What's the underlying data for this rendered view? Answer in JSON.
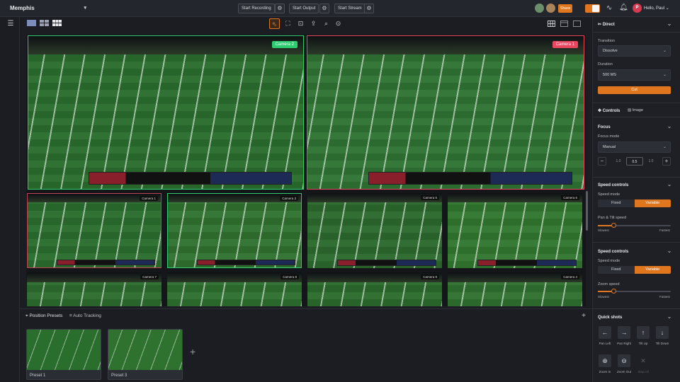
{
  "topbar": {
    "project": "Memphis",
    "start_recording": "Start Recording",
    "start_output": "Start Output",
    "start_stream": "Start Stream",
    "share": "Share",
    "greeting": "Hello, Paul",
    "user_initial": "P"
  },
  "cameras": {
    "main": [
      {
        "label": "Camera 2",
        "color": "#2ecc71"
      },
      {
        "label": "Camera 1",
        "color": "#e8475f"
      }
    ],
    "small": [
      "Camera 1",
      "Camera 3",
      "Camera 5",
      "Camera 6",
      "Camera 7",
      "Camera 8",
      "Camera 9",
      "Camera 4"
    ]
  },
  "bottom": {
    "tab_presets": "Position Presets",
    "tab_tracking": "Auto Tracking",
    "presets": [
      "Preset 1",
      "Preset 3"
    ]
  },
  "right": {
    "section_title": "Direct",
    "transition_label": "Transition",
    "transition_value": "Dissolve",
    "duration_label": "Duration",
    "duration_value": "500 MS",
    "cut_label": "Cut",
    "tab_controls": "Controls",
    "tab_image": "Image",
    "focus": {
      "title": "Focus",
      "mode_label": "Focus mode",
      "mode_value": "Manual",
      "steps": [
        "1.0",
        "0.5",
        "1.0"
      ]
    },
    "speed1": {
      "title": "Speed controls",
      "mode_label": "Speed mode",
      "options": [
        "Fixed",
        "Variable"
      ],
      "selected": "Variable",
      "slider_label": "Pan & Tilt speed",
      "slider_value": 0.22,
      "min_label": "Slowest",
      "max_label": "Fastest"
    },
    "speed2": {
      "title": "Speed controls",
      "mode_label": "Speed mode",
      "options": [
        "Fixed",
        "Variable"
      ],
      "selected": "Variable",
      "slider_label": "Zoom speed",
      "slider_value": 0.22,
      "min_label": "Slowest",
      "max_label": "Fastest"
    },
    "quickshots": {
      "title": "Quick shots",
      "items": [
        {
          "label": "Pan Left",
          "icon": "arrow-left-icon",
          "glyph": "←",
          "enabled": true
        },
        {
          "label": "Pan Right",
          "icon": "arrow-right-icon",
          "glyph": "→",
          "enabled": true
        },
        {
          "label": "Tilt Up",
          "icon": "arrow-up-icon",
          "glyph": "↑",
          "enabled": true
        },
        {
          "label": "Tilt Down",
          "icon": "arrow-down-icon",
          "glyph": "↓",
          "enabled": true
        },
        {
          "label": "Zoom In",
          "icon": "zoom-in-icon",
          "glyph": "⊕",
          "enabled": true
        },
        {
          "label": "Zoom Out",
          "icon": "zoom-out-icon",
          "glyph": "⊖",
          "enabled": true
        },
        {
          "label": "Stop All",
          "icon": "stop-icon",
          "glyph": "✕",
          "enabled": false
        }
      ]
    }
  },
  "colors": {
    "accent": "#e0771f",
    "camera_active": "#2ecc71",
    "camera_program": "#e8475f"
  }
}
